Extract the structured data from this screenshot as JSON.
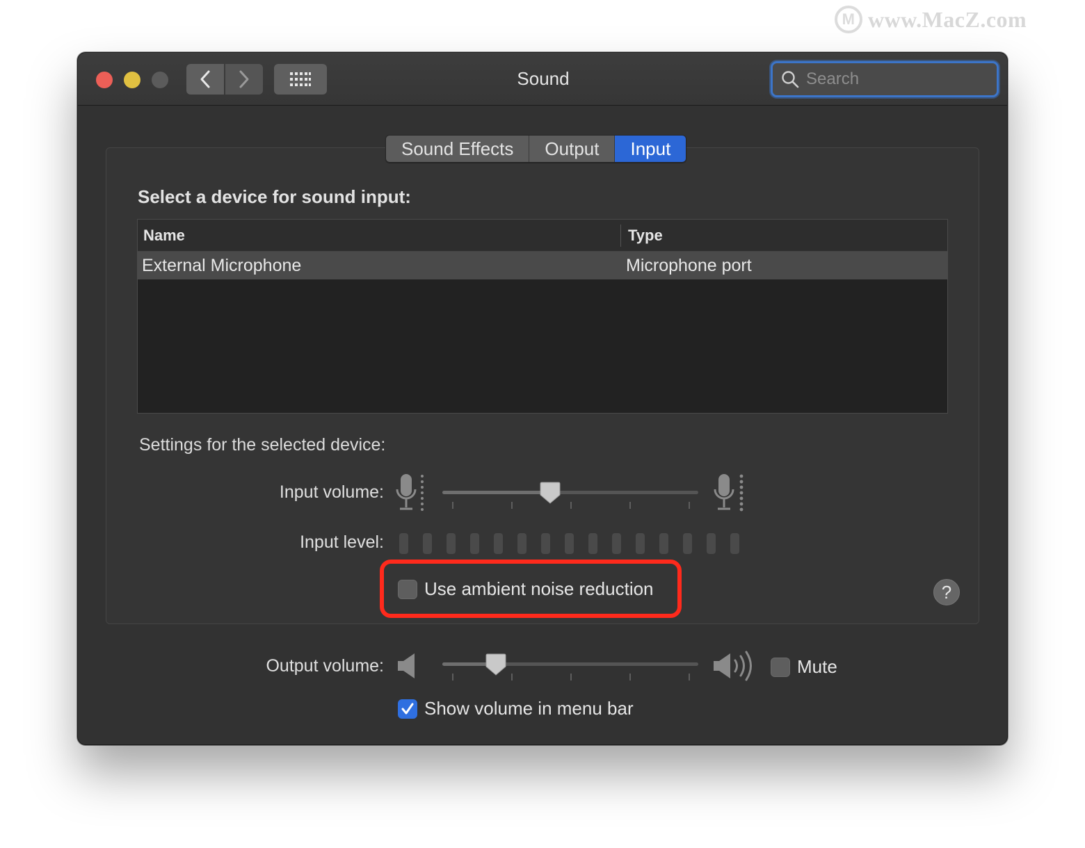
{
  "watermark": {
    "logo": "M",
    "text": "www.MacZ.com"
  },
  "window": {
    "title": "Sound",
    "search": {
      "placeholder": "Search"
    }
  },
  "tabs": [
    {
      "label": "Sound Effects",
      "active": false
    },
    {
      "label": "Output",
      "active": false
    },
    {
      "label": "Input",
      "active": true
    }
  ],
  "input_panel": {
    "heading": "Select a device for sound input:",
    "table": {
      "columns": [
        "Name",
        "Type"
      ],
      "rows": [
        {
          "name": "External Microphone",
          "type": "Microphone port",
          "selected": true
        }
      ]
    },
    "settings_label": "Settings for the selected device:",
    "input_volume": {
      "label": "Input volume:",
      "value_fraction": 0.42
    },
    "input_level": {
      "label": "Input level:",
      "segments": 15,
      "lit": 0
    },
    "ambient_noise": {
      "label": "Use ambient noise reduction",
      "checked": false
    },
    "help": "?"
  },
  "output": {
    "label": "Output volume:",
    "value_fraction": 0.21,
    "mute": {
      "label": "Mute",
      "checked": false
    },
    "show_in_menu_bar": {
      "label": "Show volume in menu bar",
      "checked": true
    }
  },
  "colors": {
    "accent": "#2c67d6",
    "highlight_annotation": "#ff2a1c",
    "close": "#ec5f57",
    "minimize": "#e0c041"
  }
}
